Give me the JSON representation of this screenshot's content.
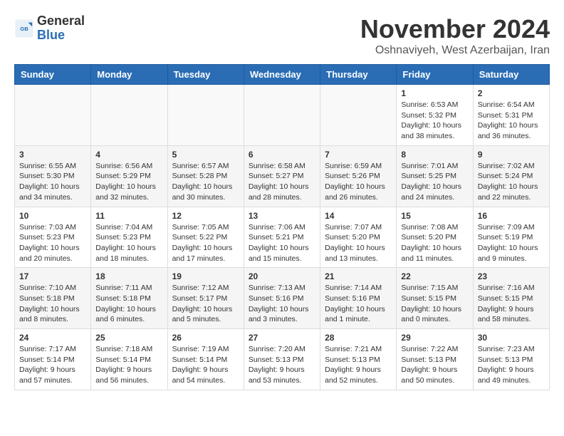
{
  "header": {
    "logo_general": "General",
    "logo_blue": "Blue",
    "month_title": "November 2024",
    "location": "Oshnaviyeh, West Azerbaijan, Iran"
  },
  "calendar": {
    "days_of_week": [
      "Sunday",
      "Monday",
      "Tuesday",
      "Wednesday",
      "Thursday",
      "Friday",
      "Saturday"
    ],
    "weeks": [
      {
        "days": [
          {
            "date": "",
            "empty": true
          },
          {
            "date": "",
            "empty": true
          },
          {
            "date": "",
            "empty": true
          },
          {
            "date": "",
            "empty": true
          },
          {
            "date": "",
            "empty": true
          },
          {
            "date": "1",
            "sunrise": "Sunrise: 6:53 AM",
            "sunset": "Sunset: 5:32 PM",
            "daylight": "Daylight: 10 hours and 38 minutes."
          },
          {
            "date": "2",
            "sunrise": "Sunrise: 6:54 AM",
            "sunset": "Sunset: 5:31 PM",
            "daylight": "Daylight: 10 hours and 36 minutes."
          }
        ]
      },
      {
        "days": [
          {
            "date": "3",
            "sunrise": "Sunrise: 6:55 AM",
            "sunset": "Sunset: 5:30 PM",
            "daylight": "Daylight: 10 hours and 34 minutes."
          },
          {
            "date": "4",
            "sunrise": "Sunrise: 6:56 AM",
            "sunset": "Sunset: 5:29 PM",
            "daylight": "Daylight: 10 hours and 32 minutes."
          },
          {
            "date": "5",
            "sunrise": "Sunrise: 6:57 AM",
            "sunset": "Sunset: 5:28 PM",
            "daylight": "Daylight: 10 hours and 30 minutes."
          },
          {
            "date": "6",
            "sunrise": "Sunrise: 6:58 AM",
            "sunset": "Sunset: 5:27 PM",
            "daylight": "Daylight: 10 hours and 28 minutes."
          },
          {
            "date": "7",
            "sunrise": "Sunrise: 6:59 AM",
            "sunset": "Sunset: 5:26 PM",
            "daylight": "Daylight: 10 hours and 26 minutes."
          },
          {
            "date": "8",
            "sunrise": "Sunrise: 7:01 AM",
            "sunset": "Sunset: 5:25 PM",
            "daylight": "Daylight: 10 hours and 24 minutes."
          },
          {
            "date": "9",
            "sunrise": "Sunrise: 7:02 AM",
            "sunset": "Sunset: 5:24 PM",
            "daylight": "Daylight: 10 hours and 22 minutes."
          }
        ]
      },
      {
        "days": [
          {
            "date": "10",
            "sunrise": "Sunrise: 7:03 AM",
            "sunset": "Sunset: 5:23 PM",
            "daylight": "Daylight: 10 hours and 20 minutes."
          },
          {
            "date": "11",
            "sunrise": "Sunrise: 7:04 AM",
            "sunset": "Sunset: 5:23 PM",
            "daylight": "Daylight: 10 hours and 18 minutes."
          },
          {
            "date": "12",
            "sunrise": "Sunrise: 7:05 AM",
            "sunset": "Sunset: 5:22 PM",
            "daylight": "Daylight: 10 hours and 17 minutes."
          },
          {
            "date": "13",
            "sunrise": "Sunrise: 7:06 AM",
            "sunset": "Sunset: 5:21 PM",
            "daylight": "Daylight: 10 hours and 15 minutes."
          },
          {
            "date": "14",
            "sunrise": "Sunrise: 7:07 AM",
            "sunset": "Sunset: 5:20 PM",
            "daylight": "Daylight: 10 hours and 13 minutes."
          },
          {
            "date": "15",
            "sunrise": "Sunrise: 7:08 AM",
            "sunset": "Sunset: 5:20 PM",
            "daylight": "Daylight: 10 hours and 11 minutes."
          },
          {
            "date": "16",
            "sunrise": "Sunrise: 7:09 AM",
            "sunset": "Sunset: 5:19 PM",
            "daylight": "Daylight: 10 hours and 9 minutes."
          }
        ]
      },
      {
        "days": [
          {
            "date": "17",
            "sunrise": "Sunrise: 7:10 AM",
            "sunset": "Sunset: 5:18 PM",
            "daylight": "Daylight: 10 hours and 8 minutes."
          },
          {
            "date": "18",
            "sunrise": "Sunrise: 7:11 AM",
            "sunset": "Sunset: 5:18 PM",
            "daylight": "Daylight: 10 hours and 6 minutes."
          },
          {
            "date": "19",
            "sunrise": "Sunrise: 7:12 AM",
            "sunset": "Sunset: 5:17 PM",
            "daylight": "Daylight: 10 hours and 5 minutes."
          },
          {
            "date": "20",
            "sunrise": "Sunrise: 7:13 AM",
            "sunset": "Sunset: 5:16 PM",
            "daylight": "Daylight: 10 hours and 3 minutes."
          },
          {
            "date": "21",
            "sunrise": "Sunrise: 7:14 AM",
            "sunset": "Sunset: 5:16 PM",
            "daylight": "Daylight: 10 hours and 1 minute."
          },
          {
            "date": "22",
            "sunrise": "Sunrise: 7:15 AM",
            "sunset": "Sunset: 5:15 PM",
            "daylight": "Daylight: 10 hours and 0 minutes."
          },
          {
            "date": "23",
            "sunrise": "Sunrise: 7:16 AM",
            "sunset": "Sunset: 5:15 PM",
            "daylight": "Daylight: 9 hours and 58 minutes."
          }
        ]
      },
      {
        "days": [
          {
            "date": "24",
            "sunrise": "Sunrise: 7:17 AM",
            "sunset": "Sunset: 5:14 PM",
            "daylight": "Daylight: 9 hours and 57 minutes."
          },
          {
            "date": "25",
            "sunrise": "Sunrise: 7:18 AM",
            "sunset": "Sunset: 5:14 PM",
            "daylight": "Daylight: 9 hours and 56 minutes."
          },
          {
            "date": "26",
            "sunrise": "Sunrise: 7:19 AM",
            "sunset": "Sunset: 5:14 PM",
            "daylight": "Daylight: 9 hours and 54 minutes."
          },
          {
            "date": "27",
            "sunrise": "Sunrise: 7:20 AM",
            "sunset": "Sunset: 5:13 PM",
            "daylight": "Daylight: 9 hours and 53 minutes."
          },
          {
            "date": "28",
            "sunrise": "Sunrise: 7:21 AM",
            "sunset": "Sunset: 5:13 PM",
            "daylight": "Daylight: 9 hours and 52 minutes."
          },
          {
            "date": "29",
            "sunrise": "Sunrise: 7:22 AM",
            "sunset": "Sunset: 5:13 PM",
            "daylight": "Daylight: 9 hours and 50 minutes."
          },
          {
            "date": "30",
            "sunrise": "Sunrise: 7:23 AM",
            "sunset": "Sunset: 5:13 PM",
            "daylight": "Daylight: 9 hours and 49 minutes."
          }
        ]
      }
    ]
  }
}
